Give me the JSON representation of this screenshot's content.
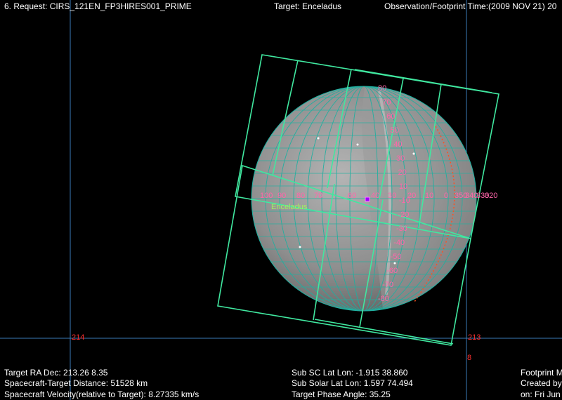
{
  "header": {
    "request": "6. Request: CIRS_121EN_FP3HIRES001_PRIME",
    "target": "Target: Enceladus",
    "obs_time": "Observation/Footprint Time:(2009 NOV 21) 20"
  },
  "axes": {
    "ra_left": "214",
    "ra_right": "213",
    "dec_right": "8"
  },
  "body_label": "Enceladus",
  "lat_labels": [
    "80",
    "70",
    "60",
    "50",
    "40",
    "30",
    "20",
    "10",
    "-10",
    "-20",
    "-30",
    "-40",
    "-50",
    "-60",
    "-70",
    "-80"
  ],
  "lon_labels": [
    "100",
    "90",
    "80",
    "70",
    "60",
    "40",
    "30",
    "20",
    "10",
    "0",
    "350",
    "340",
    "330",
    "320"
  ],
  "footer": {
    "ra_dec": "Target RA Dec: 213.26    8.35",
    "distance": "Spacecraft-Target Distance:    51528 km",
    "velocity": "Spacecraft Velocity(relative to Target): 8.27335 km/s",
    "sub_sc": "Sub SC Lat Lon:  -1.915  38.860",
    "sub_solar": "Sub Solar Lat Lon:   1.597   74.494",
    "phase": "Target Phase Angle: 35.25",
    "footprint": "Footprint M",
    "created_by": "Created by",
    "on_date": "on: Fri Jun"
  },
  "colors": {
    "footprint": "#40e8a0",
    "grid": "#20b0a0",
    "axis_line": "#3a7ab8",
    "pink_label": "#ff66aa",
    "label_green": "#a0f060"
  }
}
